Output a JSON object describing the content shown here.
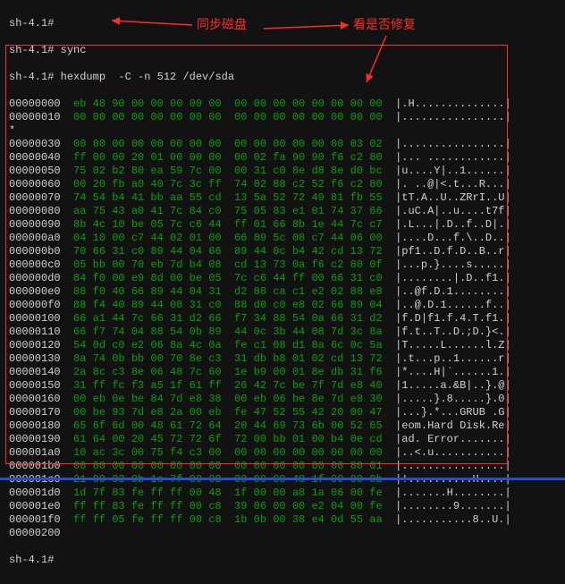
{
  "prompt": "sh-4.1#",
  "cmd_sync": "sync",
  "cmd_hexdump": "hexdump  -C -n 512 /dev/sda",
  "annotations": {
    "left": "同步磁盘",
    "right": "看是否修复"
  },
  "hex": [
    {
      "addr": "00000000",
      "b": [
        "eb",
        "48",
        "90",
        "00",
        "00",
        "00",
        "00",
        "00",
        "00",
        "00",
        "00",
        "00",
        "00",
        "00",
        "00",
        "00"
      ],
      "a": ".H.............."
    },
    {
      "addr": "00000010",
      "b": [
        "00",
        "00",
        "00",
        "00",
        "00",
        "00",
        "00",
        "00",
        "00",
        "00",
        "00",
        "00",
        "00",
        "00",
        "00",
        "00"
      ],
      "a": "................"
    },
    {
      "addr": "*",
      "b": [],
      "a": ""
    },
    {
      "addr": "00000030",
      "b": [
        "00",
        "00",
        "00",
        "00",
        "00",
        "00",
        "00",
        "00",
        "00",
        "00",
        "00",
        "00",
        "00",
        "00",
        "03",
        "02"
      ],
      "a": "................"
    },
    {
      "addr": "00000040",
      "b": [
        "ff",
        "00",
        "00",
        "20",
        "01",
        "00",
        "00",
        "00",
        "00",
        "02",
        "fa",
        "90",
        "90",
        "f6",
        "c2",
        "80"
      ],
      "a": "... ............"
    },
    {
      "addr": "00000050",
      "b": [
        "75",
        "02",
        "b2",
        "80",
        "ea",
        "59",
        "7c",
        "00",
        "00",
        "31",
        "c0",
        "8e",
        "d8",
        "8e",
        "d0",
        "bc"
      ],
      "a": "u....Y|..1......"
    },
    {
      "addr": "00000060",
      "b": [
        "00",
        "20",
        "fb",
        "a0",
        "40",
        "7c",
        "3c",
        "ff",
        "74",
        "02",
        "88",
        "c2",
        "52",
        "f6",
        "c2",
        "80"
      ],
      "a": ". ..@|<.t...R..."
    },
    {
      "addr": "00000070",
      "b": [
        "74",
        "54",
        "b4",
        "41",
        "bb",
        "aa",
        "55",
        "cd",
        "13",
        "5a",
        "52",
        "72",
        "49",
        "81",
        "fb",
        "55"
      ],
      "a": "tT.A..U..ZRrI..U"
    },
    {
      "addr": "00000080",
      "b": [
        "aa",
        "75",
        "43",
        "a0",
        "41",
        "7c",
        "84",
        "c0",
        "75",
        "05",
        "83",
        "e1",
        "01",
        "74",
        "37",
        "66"
      ],
      "a": ".uC.A|..u....t7f"
    },
    {
      "addr": "00000090",
      "b": [
        "8b",
        "4c",
        "10",
        "be",
        "05",
        "7c",
        "c6",
        "44",
        "ff",
        "01",
        "66",
        "8b",
        "1e",
        "44",
        "7c",
        "c7"
      ],
      "a": ".L...|.D..f..D|."
    },
    {
      "addr": "000000a0",
      "b": [
        "04",
        "10",
        "00",
        "c7",
        "44",
        "02",
        "01",
        "00",
        "66",
        "89",
        "5c",
        "08",
        "c7",
        "44",
        "06",
        "00"
      ],
      "a": "....D...f.\\..D.."
    },
    {
      "addr": "000000b0",
      "b": [
        "70",
        "66",
        "31",
        "c0",
        "89",
        "44",
        "04",
        "66",
        "89",
        "44",
        "0c",
        "b4",
        "42",
        "cd",
        "13",
        "72"
      ],
      "a": "pf1..D.f.D..B..r"
    },
    {
      "addr": "000000c0",
      "b": [
        "05",
        "bb",
        "00",
        "70",
        "eb",
        "7d",
        "b4",
        "08",
        "cd",
        "13",
        "73",
        "0a",
        "f6",
        "c2",
        "80",
        "0f"
      ],
      "a": "...p.}....s....."
    },
    {
      "addr": "000000d0",
      "b": [
        "84",
        "f0",
        "00",
        "e9",
        "8d",
        "00",
        "be",
        "05",
        "7c",
        "c6",
        "44",
        "ff",
        "00",
        "66",
        "31",
        "c0"
      ],
      "a": "........|.D..f1."
    },
    {
      "addr": "000000e0",
      "b": [
        "88",
        "f0",
        "40",
        "66",
        "89",
        "44",
        "04",
        "31",
        "d2",
        "88",
        "ca",
        "c1",
        "e2",
        "02",
        "88",
        "e8"
      ],
      "a": "..@f.D.1........"
    },
    {
      "addr": "000000f0",
      "b": [
        "88",
        "f4",
        "40",
        "89",
        "44",
        "08",
        "31",
        "c0",
        "88",
        "d0",
        "c0",
        "e8",
        "02",
        "66",
        "89",
        "04"
      ],
      "a": "..@.D.1......f.."
    },
    {
      "addr": "00000100",
      "b": [
        "66",
        "a1",
        "44",
        "7c",
        "66",
        "31",
        "d2",
        "66",
        "f7",
        "34",
        "88",
        "54",
        "0a",
        "66",
        "31",
        "d2"
      ],
      "a": "f.D|f1.f.4.T.f1."
    },
    {
      "addr": "00000110",
      "b": [
        "66",
        "f7",
        "74",
        "04",
        "88",
        "54",
        "0b",
        "89",
        "44",
        "0c",
        "3b",
        "44",
        "08",
        "7d",
        "3c",
        "8a"
      ],
      "a": "f.t..T..D.;D.}<."
    },
    {
      "addr": "00000120",
      "b": [
        "54",
        "0d",
        "c0",
        "e2",
        "06",
        "8a",
        "4c",
        "0a",
        "fe",
        "c1",
        "08",
        "d1",
        "8a",
        "6c",
        "0c",
        "5a"
      ],
      "a": "T.....L......l.Z"
    },
    {
      "addr": "00000130",
      "b": [
        "8a",
        "74",
        "0b",
        "bb",
        "00",
        "70",
        "8e",
        "c3",
        "31",
        "db",
        "b8",
        "01",
        "02",
        "cd",
        "13",
        "72"
      ],
      "a": ".t...p..1......r"
    },
    {
      "addr": "00000140",
      "b": [
        "2a",
        "8c",
        "c3",
        "8e",
        "06",
        "48",
        "7c",
        "60",
        "1e",
        "b9",
        "00",
        "01",
        "8e",
        "db",
        "31",
        "f6"
      ],
      "a": "*....H|`......1."
    },
    {
      "addr": "00000150",
      "b": [
        "31",
        "ff",
        "fc",
        "f3",
        "a5",
        "1f",
        "61",
        "ff",
        "26",
        "42",
        "7c",
        "be",
        "7f",
        "7d",
        "e8",
        "40"
      ],
      "a": "1.....a.&B|..}.@"
    },
    {
      "addr": "00000160",
      "b": [
        "00",
        "eb",
        "0e",
        "be",
        "84",
        "7d",
        "e8",
        "38",
        "00",
        "eb",
        "06",
        "be",
        "8e",
        "7d",
        "e8",
        "30"
      ],
      "a": ".....}.8.....}.0"
    },
    {
      "addr": "00000170",
      "b": [
        "00",
        "be",
        "93",
        "7d",
        "e8",
        "2a",
        "00",
        "eb",
        "fe",
        "47",
        "52",
        "55",
        "42",
        "20",
        "00",
        "47"
      ],
      "a": "...}.*...GRUB .G"
    },
    {
      "addr": "00000180",
      "b": [
        "65",
        "6f",
        "6d",
        "00",
        "48",
        "61",
        "72",
        "64",
        "20",
        "44",
        "69",
        "73",
        "6b",
        "00",
        "52",
        "65"
      ],
      "a": "eom.Hard Disk.Re"
    },
    {
      "addr": "00000190",
      "b": [
        "61",
        "64",
        "00",
        "20",
        "45",
        "72",
        "72",
        "6f",
        "72",
        "00",
        "bb",
        "01",
        "00",
        "b4",
        "0e",
        "cd"
      ],
      "a": "ad. Error......."
    },
    {
      "addr": "000001a0",
      "b": [
        "10",
        "ac",
        "3c",
        "00",
        "75",
        "f4",
        "c3",
        "00",
        "00",
        "00",
        "00",
        "00",
        "00",
        "00",
        "00",
        "00"
      ],
      "a": "..<.u..........."
    },
    {
      "addr": "000001b0",
      "b": [
        "00",
        "00",
        "00",
        "00",
        "00",
        "00",
        "00",
        "00",
        "00",
        "00",
        "00",
        "00",
        "00",
        "00",
        "80",
        "01"
      ],
      "a": "................"
    },
    {
      "addr": "000001c0",
      "b": [
        "21",
        "00",
        "83",
        "9b",
        "1c",
        "7f",
        "00",
        "08",
        "00",
        "00",
        "00",
        "48",
        "1f",
        "00",
        "00",
        "9b"
      ],
      "a": "!..........H...."
    },
    {
      "addr": "000001d0",
      "b": [
        "1d",
        "7f",
        "83",
        "fe",
        "ff",
        "ff",
        "00",
        "48",
        "1f",
        "00",
        "00",
        "a8",
        "1a",
        "06",
        "00",
        "fe"
      ],
      "a": ".......H........"
    },
    {
      "addr": "000001e0",
      "b": [
        "ff",
        "ff",
        "83",
        "fe",
        "ff",
        "ff",
        "00",
        "c8",
        "39",
        "06",
        "00",
        "00",
        "e2",
        "04",
        "00",
        "fe"
      ],
      "a": "........9......."
    },
    {
      "addr": "000001f0",
      "b": [
        "ff",
        "ff",
        "05",
        "fe",
        "ff",
        "ff",
        "00",
        "c8",
        "1b",
        "0b",
        "00",
        "38",
        "e4",
        "0d",
        "55",
        "aa"
      ],
      "a": "...........8..U."
    },
    {
      "addr": "00000200",
      "b": [],
      "a": ""
    }
  ]
}
